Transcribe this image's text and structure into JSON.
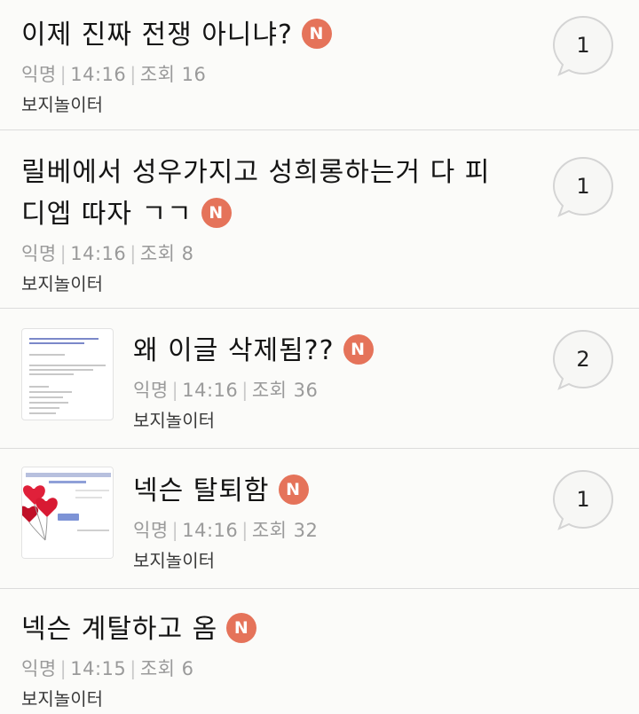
{
  "posts": [
    {
      "title": "이제 진짜 전쟁 아니냐?",
      "badge": "N",
      "author": "익명",
      "time": "14:16",
      "views_label": "조회",
      "views": "16",
      "board": "보지놀이터",
      "comments": "1",
      "has_thumbnail": false
    },
    {
      "title": "릴베에서 성우가지고 성희롱하는거 다 피디엡 따자 ㄱㄱ",
      "badge": "N",
      "author": "익명",
      "time": "14:16",
      "views_label": "조회",
      "views": "8",
      "board": "보지놀이터",
      "comments": "1",
      "has_thumbnail": false
    },
    {
      "title": "왜 이글 삭제됨??",
      "badge": "N",
      "author": "익명",
      "time": "14:16",
      "views_label": "조회",
      "views": "36",
      "board": "보지놀이터",
      "comments": "2",
      "has_thumbnail": true
    },
    {
      "title": "넥슨 탈퇴함",
      "badge": "N",
      "author": "익명",
      "time": "14:16",
      "views_label": "조회",
      "views": "32",
      "board": "보지놀이터",
      "comments": "1",
      "has_thumbnail": true
    },
    {
      "title": "넥슨 계탈하고 옴",
      "badge": "N",
      "author": "익명",
      "time": "14:15",
      "views_label": "조회",
      "views": "6",
      "board": "보지놀이터",
      "comments": "",
      "has_thumbnail": false
    }
  ],
  "colors": {
    "badge": "#e5735a",
    "meta": "#9a9a9a",
    "divider": "#dcdcdc",
    "background": "#fbfbf9"
  },
  "icons": {
    "comment_bubble": "speech-bubble-icon",
    "thumbnail_2": "heart-balloons-image"
  }
}
